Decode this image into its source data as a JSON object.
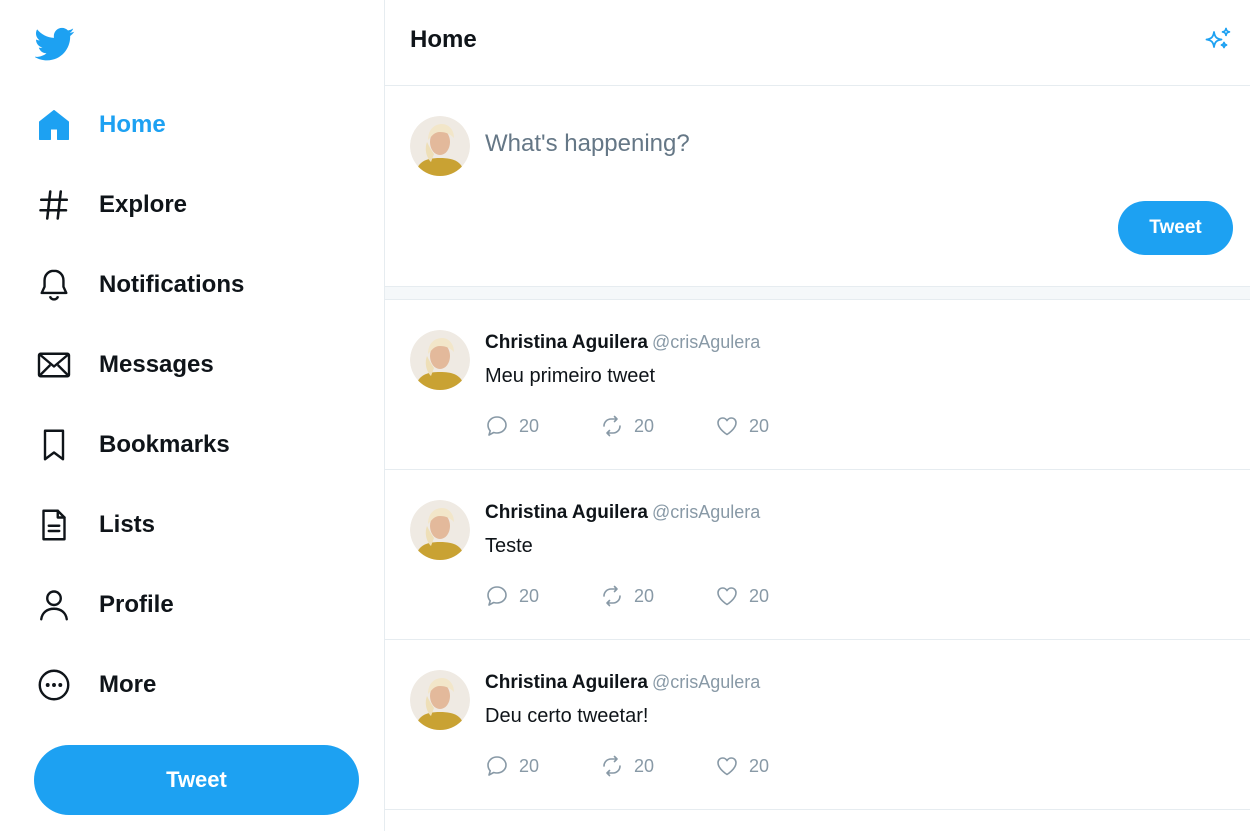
{
  "colors": {
    "accent": "#1da1f2",
    "text": "#0f1419",
    "muted": "#8899a6",
    "border": "#e6ecf0"
  },
  "sidebar": {
    "logo_icon": "twitter-bird-icon",
    "items": [
      {
        "label": "Home",
        "icon": "home-icon",
        "active": true
      },
      {
        "label": "Explore",
        "icon": "hashtag-icon"
      },
      {
        "label": "Notifications",
        "icon": "bell-icon"
      },
      {
        "label": "Messages",
        "icon": "envelope-icon"
      },
      {
        "label": "Bookmarks",
        "icon": "bookmark-icon"
      },
      {
        "label": "Lists",
        "icon": "list-document-icon"
      },
      {
        "label": "Profile",
        "icon": "person-icon"
      },
      {
        "label": "More",
        "icon": "more-circle-icon"
      }
    ],
    "tweet_button": "Tweet"
  },
  "header": {
    "title": "Home",
    "icon": "sparkle-icon"
  },
  "composer": {
    "placeholder": "What's happening?",
    "tweet_button": "Tweet"
  },
  "tweets": [
    {
      "name": "Christina Aguilera",
      "handle": "@crisAgulera",
      "text": "Meu primeiro tweet",
      "replies": "20",
      "retweets": "20",
      "likes": "20"
    },
    {
      "name": "Christina Aguilera",
      "handle": "@crisAgulera",
      "text": "Teste",
      "replies": "20",
      "retweets": "20",
      "likes": "20"
    },
    {
      "name": "Christina Aguilera",
      "handle": "@crisAgulera",
      "text": "Deu certo tweetar!",
      "replies": "20",
      "retweets": "20",
      "likes": "20"
    }
  ]
}
